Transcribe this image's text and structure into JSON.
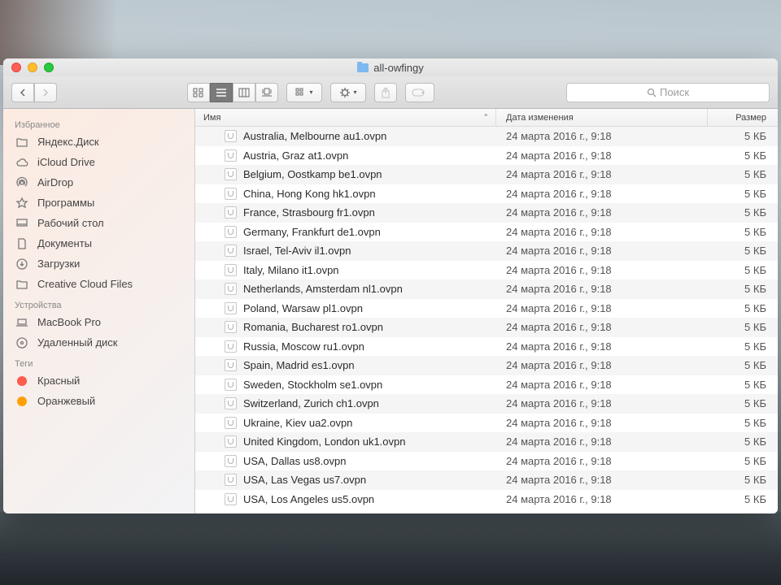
{
  "window": {
    "title": "all-owfingy"
  },
  "toolbar": {
    "search_placeholder": "Поиск"
  },
  "sidebar": {
    "favorites_header": "Избранное",
    "favorites": [
      {
        "label": "Яндекс.Диск",
        "icon": "folder"
      },
      {
        "label": "iCloud Drive",
        "icon": "cloud"
      },
      {
        "label": "AirDrop",
        "icon": "airdrop"
      },
      {
        "label": "Программы",
        "icon": "apps"
      },
      {
        "label": "Рабочий стол",
        "icon": "desktop"
      },
      {
        "label": "Документы",
        "icon": "documents"
      },
      {
        "label": "Загрузки",
        "icon": "downloads"
      },
      {
        "label": "Creative Cloud Files",
        "icon": "folder"
      }
    ],
    "devices_header": "Устройства",
    "devices": [
      {
        "label": "MacBook Pro",
        "icon": "laptop"
      },
      {
        "label": "Удаленный диск",
        "icon": "disc"
      }
    ],
    "tags_header": "Теги",
    "tags": [
      {
        "label": "Красный",
        "color": "#ff5b4f"
      },
      {
        "label": "Оранжевый",
        "color": "#ff9f0a"
      }
    ]
  },
  "columns": {
    "name": "Имя",
    "date": "Дата изменения",
    "size": "Размер"
  },
  "files": [
    {
      "name": "Australia, Melbourne au1.ovpn",
      "date": "24 марта 2016 г., 9:18",
      "size": "5 КБ"
    },
    {
      "name": "Austria, Graz at1.ovpn",
      "date": "24 марта 2016 г., 9:18",
      "size": "5 КБ"
    },
    {
      "name": "Belgium, Oostkamp be1.ovpn",
      "date": "24 марта 2016 г., 9:18",
      "size": "5 КБ"
    },
    {
      "name": "China, Hong Kong hk1.ovpn",
      "date": "24 марта 2016 г., 9:18",
      "size": "5 КБ"
    },
    {
      "name": "France, Strasbourg fr1.ovpn",
      "date": "24 марта 2016 г., 9:18",
      "size": "5 КБ"
    },
    {
      "name": "Germany, Frankfurt de1.ovpn",
      "date": "24 марта 2016 г., 9:18",
      "size": "5 КБ"
    },
    {
      "name": "Israel, Tel-Aviv il1.ovpn",
      "date": "24 марта 2016 г., 9:18",
      "size": "5 КБ"
    },
    {
      "name": "Italy, Milano it1.ovpn",
      "date": "24 марта 2016 г., 9:18",
      "size": "5 КБ"
    },
    {
      "name": "Netherlands, Amsterdam nl1.ovpn",
      "date": "24 марта 2016 г., 9:18",
      "size": "5 КБ"
    },
    {
      "name": "Poland, Warsaw pl1.ovpn",
      "date": "24 марта 2016 г., 9:18",
      "size": "5 КБ"
    },
    {
      "name": "Romania, Bucharest ro1.ovpn",
      "date": "24 марта 2016 г., 9:18",
      "size": "5 КБ"
    },
    {
      "name": "Russia, Moscow ru1.ovpn",
      "date": "24 марта 2016 г., 9:18",
      "size": "5 КБ"
    },
    {
      "name": "Spain, Madrid es1.ovpn",
      "date": "24 марта 2016 г., 9:18",
      "size": "5 КБ"
    },
    {
      "name": "Sweden, Stockholm se1.ovpn",
      "date": "24 марта 2016 г., 9:18",
      "size": "5 КБ"
    },
    {
      "name": "Switzerland, Zurich ch1.ovpn",
      "date": "24 марта 2016 г., 9:18",
      "size": "5 КБ"
    },
    {
      "name": "Ukraine, Kiev ua2.ovpn",
      "date": "24 марта 2016 г., 9:18",
      "size": "5 КБ"
    },
    {
      "name": "United Kingdom, London uk1.ovpn",
      "date": "24 марта 2016 г., 9:18",
      "size": "5 КБ"
    },
    {
      "name": "USA, Dallas us8.ovpn",
      "date": "24 марта 2016 г., 9:18",
      "size": "5 КБ"
    },
    {
      "name": "USA, Las Vegas us7.ovpn",
      "date": "24 марта 2016 г., 9:18",
      "size": "5 КБ"
    },
    {
      "name": "USA, Los Angeles us5.ovpn",
      "date": "24 марта 2016 г., 9:18",
      "size": "5 КБ"
    }
  ]
}
